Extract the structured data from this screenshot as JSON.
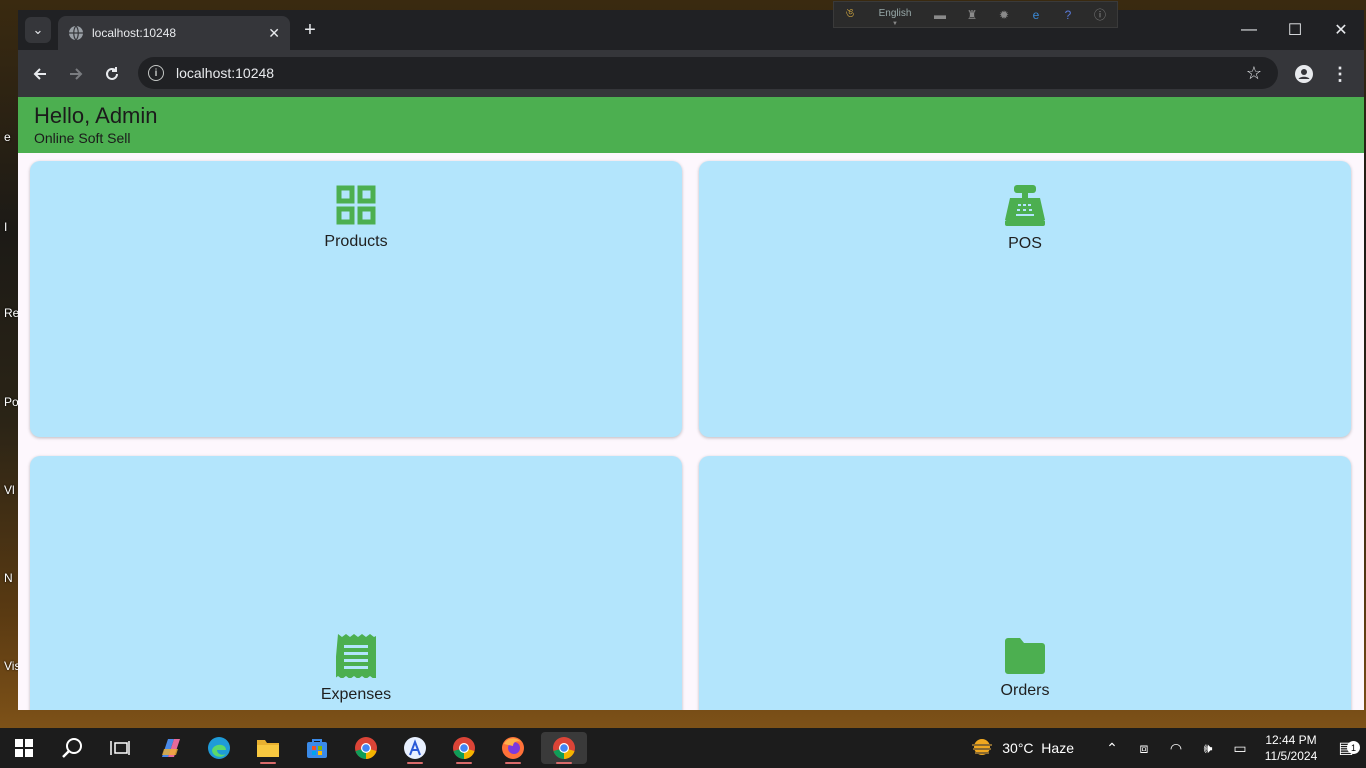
{
  "desktop": {
    "labels": [
      "e",
      "I",
      "Re",
      "Po",
      "Vl",
      "N",
      "Vis"
    ]
  },
  "ime": {
    "language": "English"
  },
  "browser": {
    "tab_title": "localhost:10248",
    "url": "localhost:10248"
  },
  "app": {
    "greeting": "Hello, Admin",
    "subtitle": "Online Soft Sell",
    "cards": [
      {
        "label": "Products",
        "icon": "grid-icon"
      },
      {
        "label": "POS",
        "icon": "cash-register-icon"
      },
      {
        "label": "Expenses",
        "icon": "receipt-icon"
      },
      {
        "label": "Orders",
        "icon": "folder-icon"
      }
    ],
    "colors": {
      "appbar": "#4caf50",
      "card": "#b3e5fc",
      "icon": "#4caf50"
    }
  },
  "taskbar": {
    "weather": "30°C  Haze",
    "time": "12:44 PM",
    "date": "11/5/2024",
    "notification_count": "1"
  }
}
